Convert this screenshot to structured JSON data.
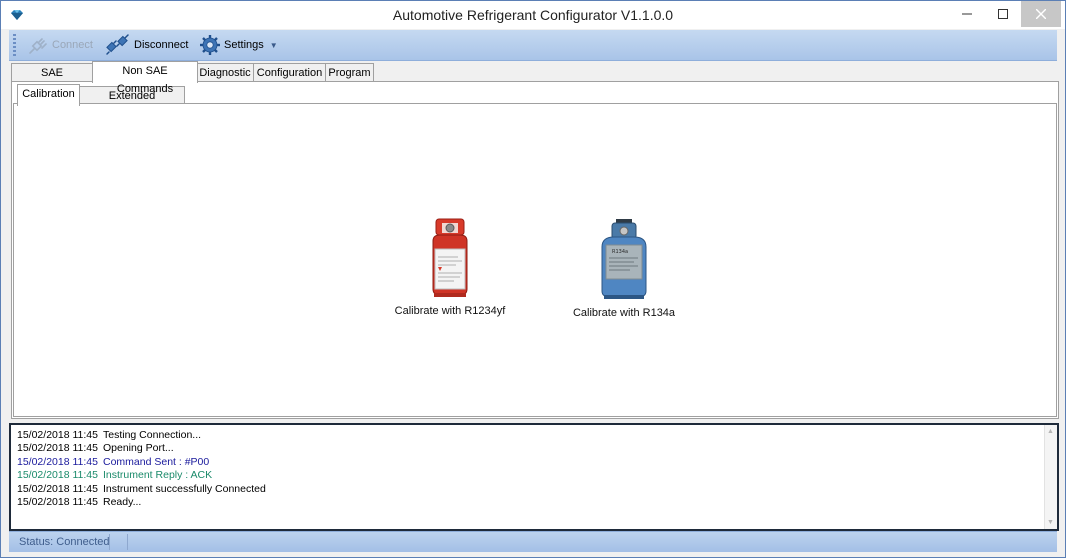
{
  "window": {
    "title": "Automotive Refrigerant Configurator V1.1.0.0",
    "icon": "diamond-app-icon",
    "controls": [
      "minimize-icon",
      "maximize-icon",
      "close-icon"
    ]
  },
  "toolbar": {
    "connect": {
      "label": "Connect",
      "icon": "plug-icon",
      "enabled": false
    },
    "disconnect": {
      "label": "Disconnect",
      "icon": "unplug-icon",
      "enabled": true
    },
    "settings": {
      "label": "Settings",
      "icon": "gear-icon",
      "dropdown": true
    }
  },
  "tabs": [
    {
      "label": "SAE Commands",
      "active": false
    },
    {
      "label": "Non SAE Commands",
      "active": true
    },
    {
      "label": "Diagnostic",
      "active": false
    },
    {
      "label": "Configuration",
      "active": false
    },
    {
      "label": "Program",
      "active": false
    }
  ],
  "subtabs": [
    {
      "label": "Calibration",
      "active": true
    },
    {
      "label": "Extended Commands",
      "active": false
    }
  ],
  "calibration": {
    "buttons": [
      {
        "label": "Calibrate with R1234yf",
        "icon": "red-refrigerant-cylinder-icon"
      },
      {
        "label": "Calibrate with R134a",
        "icon": "blue-refrigerant-cylinder-icon",
        "cylinder_text": "R134a"
      }
    ]
  },
  "log": {
    "entries": [
      {
        "time": "15/02/2018 11:45",
        "message": "Testing Connection...",
        "color": "#000000"
      },
      {
        "time": "15/02/2018 11:45",
        "message": "Opening Port...",
        "color": "#000000"
      },
      {
        "time": "15/02/2018 11:45",
        "message": "Command Sent : #P00",
        "color": "#1a1a9c"
      },
      {
        "time": "15/02/2018 11:45",
        "message": "Instrument Reply : ACK",
        "color": "#1a8a6a"
      },
      {
        "time": "15/02/2018 11:45",
        "message": "Instrument successfully Connected",
        "color": "#000000"
      },
      {
        "time": "15/02/2018 11:45",
        "message": "Ready...",
        "color": "#000000"
      }
    ]
  },
  "status": {
    "text": "Status: Connected"
  },
  "colors": {
    "toolbar_bg": "#b8cfee",
    "status_text": "#3f5d8c",
    "log_border": "#1e2a3a"
  }
}
